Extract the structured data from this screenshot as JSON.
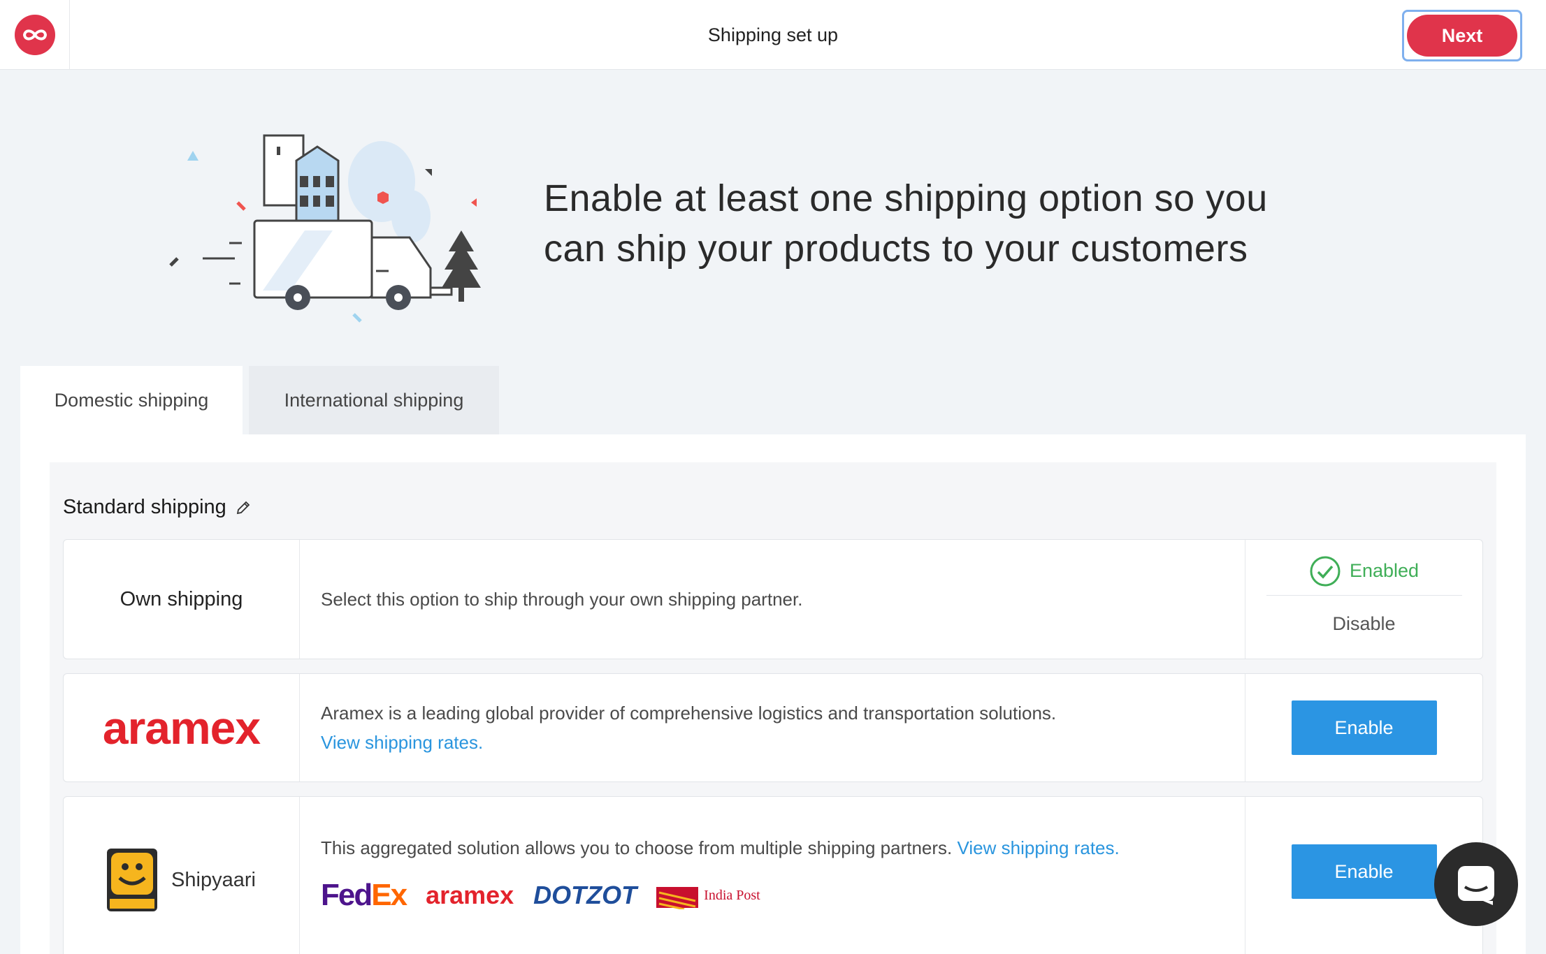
{
  "header": {
    "title": "Shipping set up",
    "next_label": "Next",
    "accent_color": "#e0344b"
  },
  "hero": {
    "line1": "Enable at least one shipping option so you",
    "line2": "can ship your products to your customers"
  },
  "tabs": [
    {
      "label": "Domestic shipping",
      "active": true
    },
    {
      "label": "International shipping",
      "active": false
    }
  ],
  "section": {
    "title": "Standard shipping"
  },
  "options": {
    "own": {
      "name": "Own shipping",
      "description": "Select this option to ship through your own shipping partner.",
      "status": "Enabled",
      "disable_label": "Disable"
    },
    "aramex": {
      "logo_text": "aramex",
      "description": "Aramex is a leading global provider of comprehensive logistics and transportation solutions.",
      "link": "View shipping rates.",
      "button": "Enable"
    },
    "shipyaari": {
      "name": "Shipyaari",
      "description": "This aggregated solution allows you to choose from multiple shipping partners.",
      "link": "View shipping rates.",
      "button": "Enable",
      "partners": [
        "FedEx",
        "aramex",
        "DOTZOT",
        "India Post"
      ]
    }
  },
  "colors": {
    "primary_blue": "#2b95e3",
    "link_blue": "#2a95de",
    "success_green": "#3fae57"
  }
}
